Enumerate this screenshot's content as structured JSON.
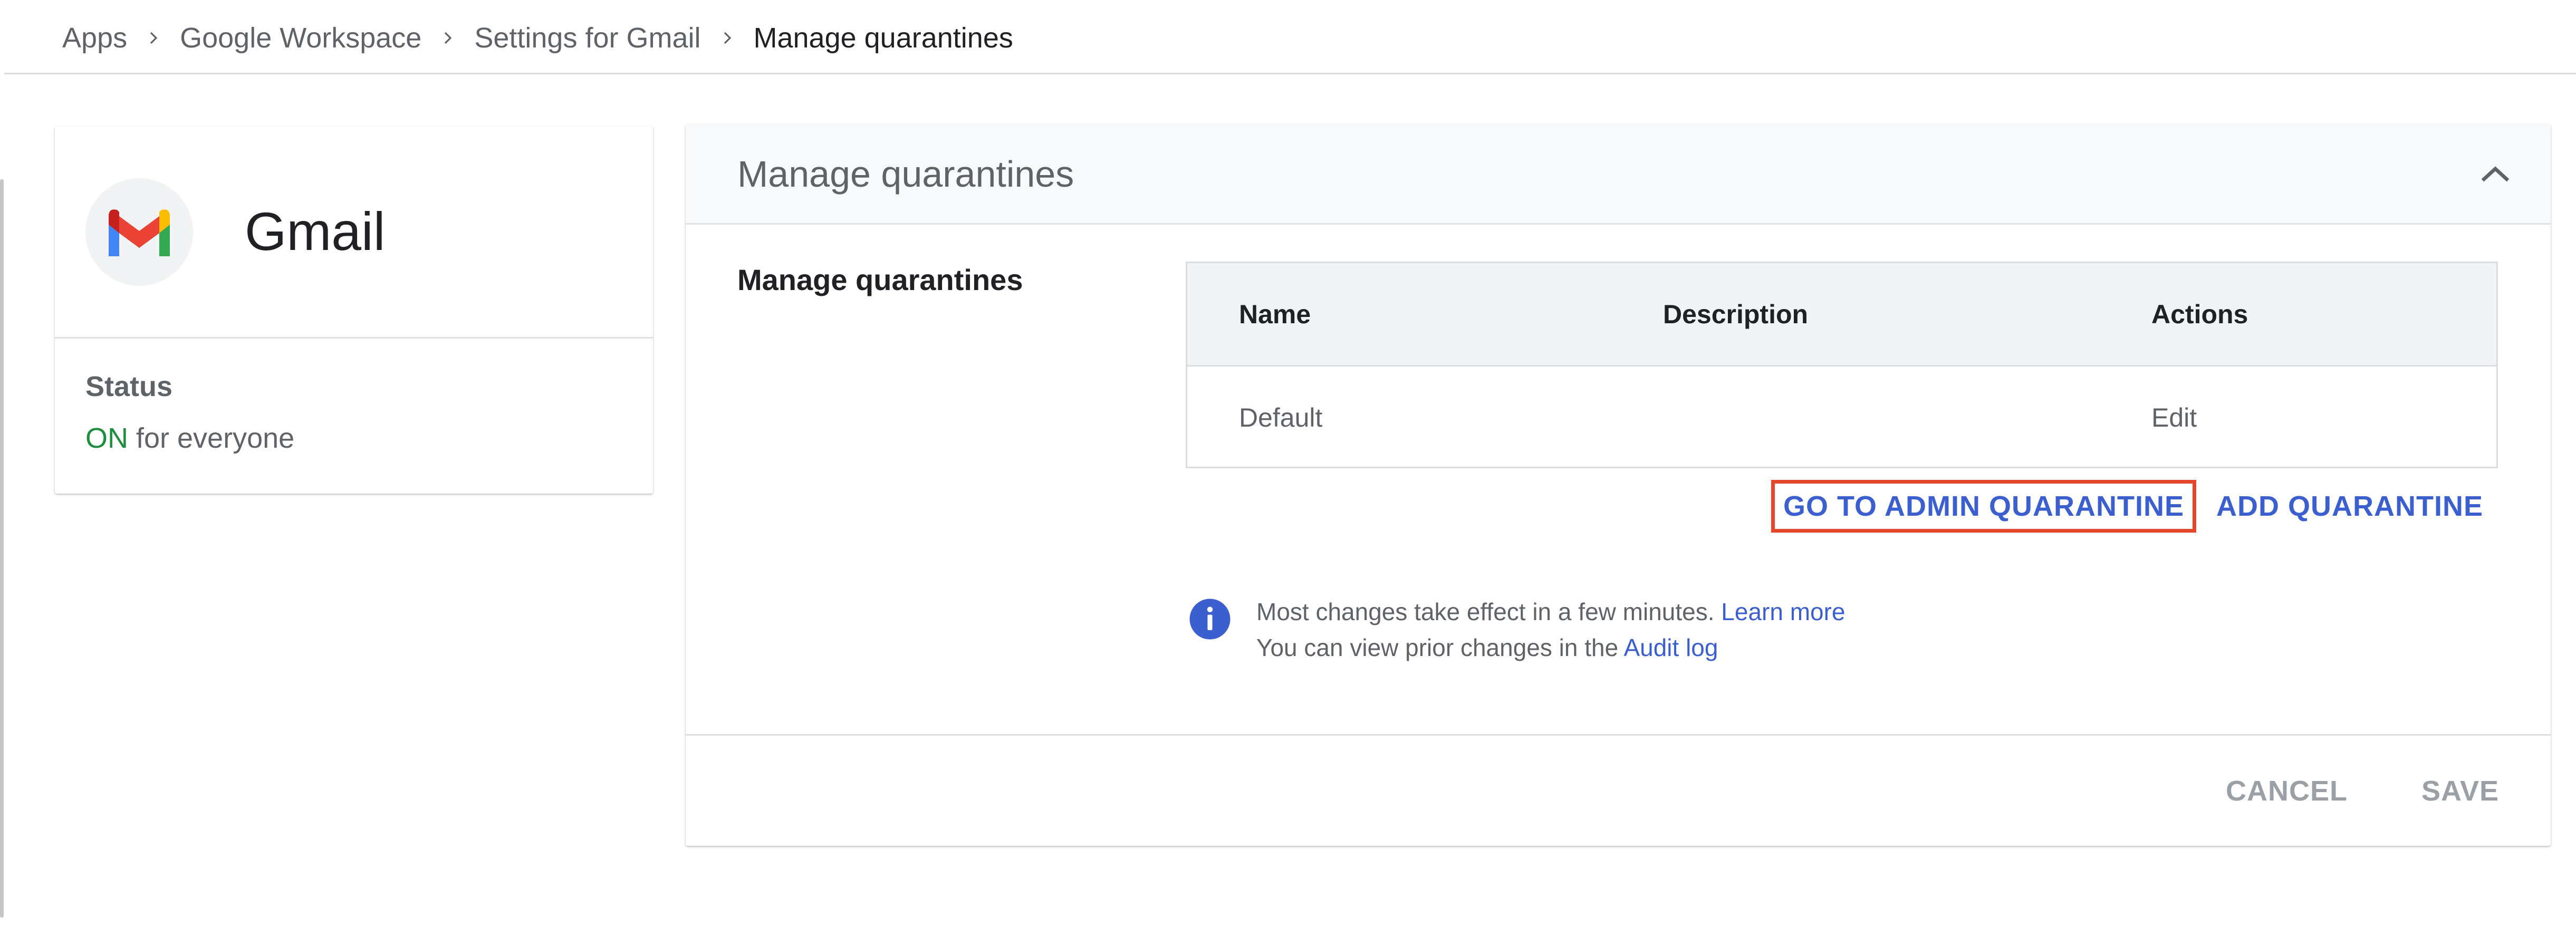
{
  "breadcrumb": {
    "items": [
      "Apps",
      "Google Workspace",
      "Settings for Gmail"
    ],
    "current": "Manage quarantines"
  },
  "app_card": {
    "name": "Gmail",
    "logo_icon": "gmail-logo",
    "status_label": "Status",
    "status_value": "ON",
    "status_suffix": " for everyone",
    "status_color": "#1e8e3e"
  },
  "panel": {
    "title": "Manage quarantines",
    "collapse_icon": "chevron-up-icon",
    "section_label": "Manage quarantines",
    "table": {
      "headers": [
        "Name",
        "Description",
        "Actions"
      ],
      "rows": [
        {
          "name": "Default",
          "description": "",
          "action": "Edit"
        }
      ]
    },
    "go_to_admin_label": "GO TO ADMIN QUARANTINE",
    "add_quarantine_label": "ADD QUARANTINE",
    "info": {
      "line1_text": "Most changes take effect in a few minutes. ",
      "line1_link": "Learn more",
      "line2_text": "You can view prior changes in the ",
      "line2_link": "Audit log"
    },
    "cancel_label": "CANCEL",
    "save_label": "SAVE"
  },
  "colors": {
    "link": "#3c5fd0",
    "highlight_border": "#e2472c",
    "disabled": "#9aa0a6"
  }
}
